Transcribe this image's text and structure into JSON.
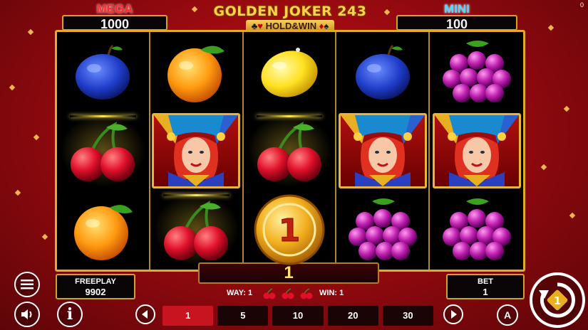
{
  "corner_indicator": "0",
  "jackpots": {
    "mega": {
      "label": "MEGA",
      "value": "1000"
    },
    "mini": {
      "label": "MINI",
      "value": "100"
    }
  },
  "logo": {
    "title": "GOLDEN JOKER 243",
    "subtitle": "HOLD&WIN"
  },
  "colors": {
    "accent_gold": "#d2a02e",
    "background_red": "#b0101a",
    "active_bet": "#c81420"
  },
  "reels": [
    [
      "plum-icon",
      "cherry-icon",
      "orange-icon"
    ],
    [
      "orange-icon",
      "joker-icon",
      "cherry-icon"
    ],
    [
      "lemon-icon",
      "cherry-icon",
      "coin-icon"
    ],
    [
      "plum-icon",
      "joker-icon",
      "grapes-icon"
    ],
    [
      "grapes-icon",
      "joker-icon",
      "grapes-icon"
    ]
  ],
  "coin_value": "1",
  "win_display": "1",
  "way_info": {
    "way_label": "WAY: 1",
    "win_label": "WIN: 1"
  },
  "freeplay": {
    "label": "FREEPLAY",
    "value": "9902"
  },
  "bet": {
    "label": "BET",
    "value": "1"
  },
  "bet_options": [
    "1",
    "5",
    "10",
    "20",
    "30"
  ],
  "selected_bet": "1",
  "buttons": {
    "info": "i",
    "auto": "A",
    "spin_badge": "1"
  }
}
